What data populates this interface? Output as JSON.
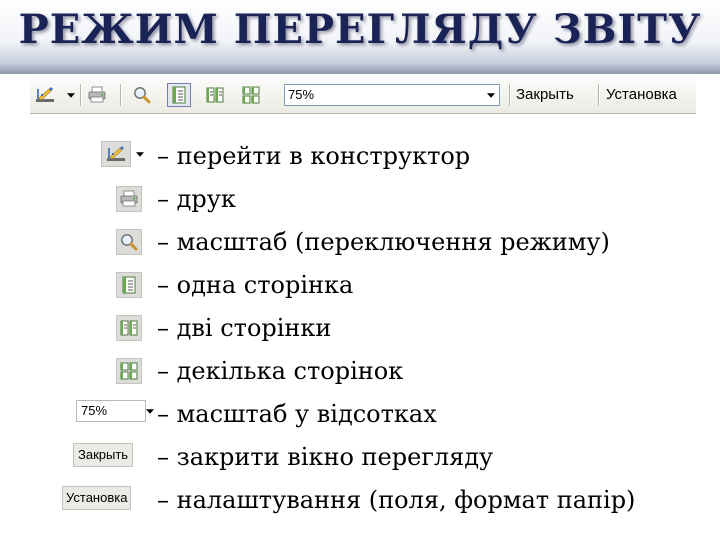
{
  "title": "РЕЖИМ ПЕРЕГЛЯДУ ЗВІТУ",
  "toolbar": {
    "icons": [
      "design-view-icon",
      "print-icon",
      "zoom-icon",
      "one-page-icon",
      "two-pages-icon",
      "multiple-pages-icon"
    ],
    "zoom_value": "75%",
    "close_label": "Закрыть",
    "setup_label": "Установка"
  },
  "legend": {
    "design": "– перейти в конструктор",
    "print": "– друк",
    "zoom": "– масштаб (переключення режиму)",
    "one_page": "– одна сторінка",
    "two_pages": "– дві сторінки",
    "multi_pages": "– декілька сторінок",
    "zoom_percent": "– масштаб у відсотках",
    "close": "– закрити вікно перегляду",
    "setup": "– налаштування (поля, формат папір)",
    "zoom_field_value": "75%",
    "close_button_label": "Закрыть",
    "setup_button_label": "Установка"
  },
  "colors": {
    "title_text": "#1a2356",
    "toolbar_bg": "#ecebe4",
    "pressed_border": "#6f7fb2"
  }
}
